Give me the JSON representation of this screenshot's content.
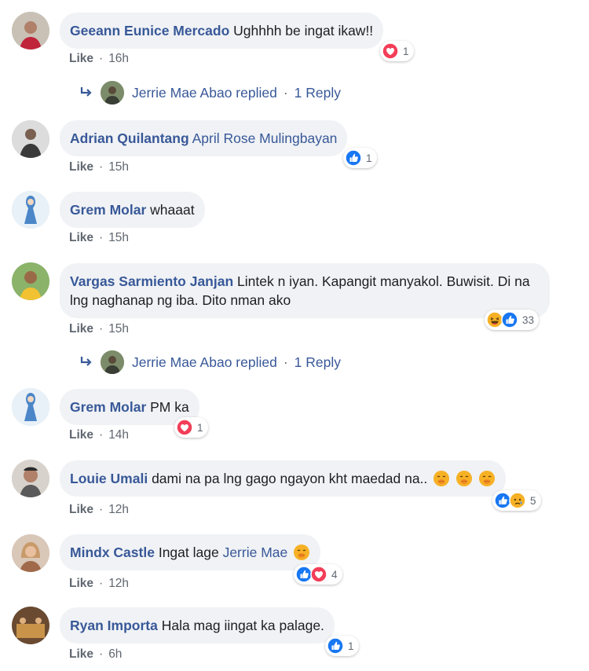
{
  "comments": [
    {
      "author": "Geeann Eunice Mercado",
      "text": "Ughhhh be ingat ikaw!!",
      "like": "Like",
      "time": "16h",
      "count": "1",
      "reactions": [
        "love"
      ]
    },
    {
      "author": "Adrian Quilantang",
      "mention": "April Rose Mulingbayan",
      "text": "",
      "like": "Like",
      "time": "15h",
      "count": "1",
      "reactions": [
        "like"
      ]
    },
    {
      "author": "Grem Molar",
      "text": "whaaat",
      "like": "Like",
      "time": "15h"
    },
    {
      "author": "Vargas Sarmiento Janjan",
      "text": "Lintek n iyan. Kapangit manyakol. Buwisit. Di na lng naghanap ng iba. Dito nman ako",
      "like": "Like",
      "time": "15h",
      "count": "33",
      "reactions": [
        "haha",
        "like"
      ]
    },
    {
      "author": "Grem Molar",
      "text": "PM ka",
      "like": "Like",
      "time": "14h",
      "count": "1",
      "reactions": [
        "love"
      ]
    },
    {
      "author": "Louie Umali",
      "text": "dami na pa lng gago ngayon kht maedad na..",
      "like": "Like",
      "time": "12h",
      "count": "5",
      "reactions": [
        "like",
        "sad"
      ],
      "emojis": [
        "hand-over-mouth",
        "hand-over-mouth",
        "hand-over-mouth"
      ]
    },
    {
      "author": "Mindx Castle",
      "text": "Ingat lage",
      "mention": "Jerrie Mae",
      "like": "Like",
      "time": "12h",
      "count": "4",
      "reactions": [
        "like",
        "love"
      ],
      "emojis": [
        "hand-over-mouth"
      ]
    },
    {
      "author": "Ryan Importa",
      "text": "Hala mag iingat ka palage.",
      "like": "Like",
      "time": "6h",
      "count": "1",
      "reactions": [
        "like"
      ]
    }
  ],
  "replies": [
    {
      "name": "Jerrie Mae Abao replied",
      "count": "1 Reply"
    },
    {
      "name": "Jerrie Mae Abao replied",
      "count": "1 Reply"
    }
  ],
  "colors": {
    "link": "#385898",
    "bubble": "#f0f2f5",
    "meta": "#606770",
    "like_blue": "#1877f2",
    "love_red": "#f33e58",
    "haha_yellow": "#f7b125"
  }
}
